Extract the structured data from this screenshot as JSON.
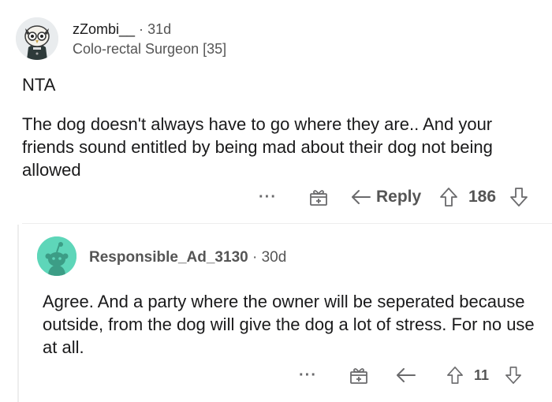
{
  "comment1": {
    "username": "zZombi__",
    "separator": "·",
    "age": "31d",
    "flair": "Colo-rectal Surgeon [35]",
    "verdict": "NTA",
    "body": "The dog doesn't always have to go where they are.. And your friends sound entitled by being mad about their dog not being allowed",
    "actions": {
      "more": "···",
      "reply_label": "Reply",
      "score": "186"
    }
  },
  "comment2": {
    "username": "Responsible_Ad_3130",
    "separator": "·",
    "age": "30d",
    "body": "Agree. And a party where the owner will be seperated because outside, from the dog will give the dog a lot of stress. For no use at all.",
    "actions": {
      "more": "···",
      "score": "11"
    }
  },
  "icons": [
    "owl-avatar-icon",
    "snoo-avatar-icon",
    "gift-award-icon",
    "reply-arrow-icon",
    "upvote-icon",
    "downvote-icon",
    "more-options-icon"
  ],
  "colors": {
    "text": "#1a1a1b",
    "meta": "#555555",
    "icon": "#6a6a6c",
    "avatar2_bg": "#5ed6b9"
  }
}
